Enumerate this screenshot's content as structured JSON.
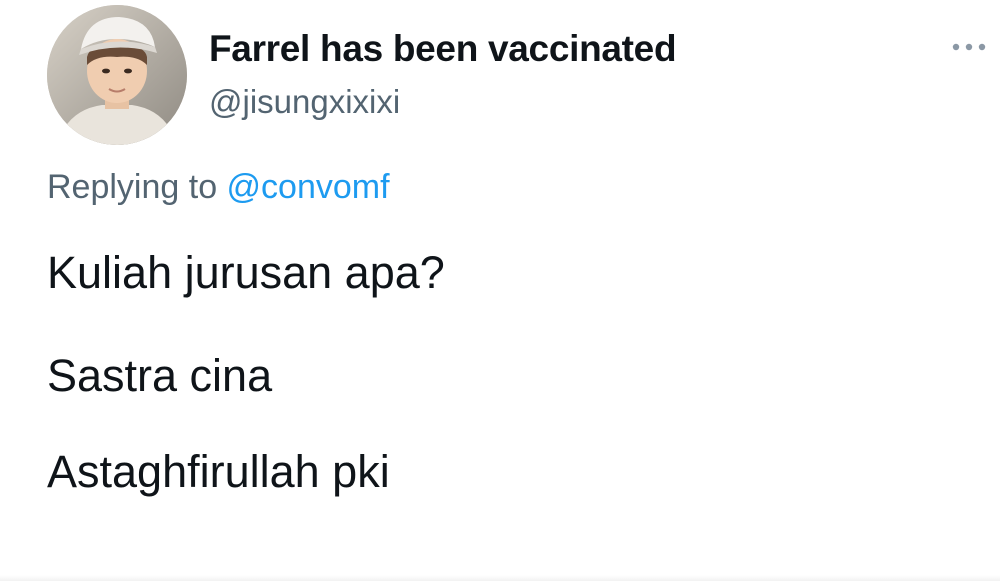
{
  "tweet": {
    "display_name": "Farrel has been vaccinated",
    "handle": "@jisungxixixi",
    "more_icon": "more-horizontal-icon",
    "replying_prefix": "Replying to ",
    "replying_to": "@convomf",
    "body_lines": [
      "Kuliah jurusan apa?",
      "Sastra cina",
      "Astaghfirullah pki"
    ]
  },
  "colors": {
    "text_primary": "#0f1419",
    "text_secondary": "#536471",
    "mention": "#1d9bf0",
    "background": "#ffffff"
  }
}
